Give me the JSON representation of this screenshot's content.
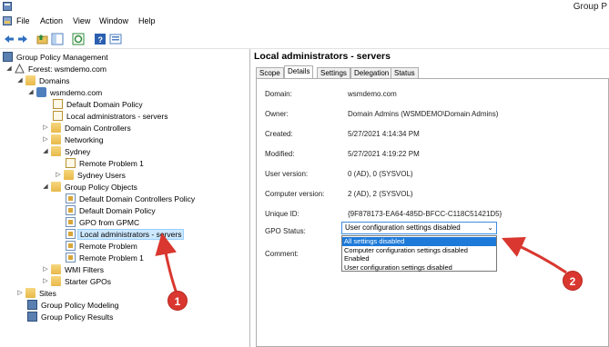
{
  "window": {
    "title": "Group P"
  },
  "menu": [
    "File",
    "Action",
    "View",
    "Window",
    "Help"
  ],
  "toolbar_icons": [
    "back-arrow-icon",
    "forward-arrow-icon",
    "up-folder-icon",
    "show-hide-tree-icon",
    "refresh-icon",
    "help-icon",
    "properties-icon"
  ],
  "tree": {
    "root": "Group Policy Management",
    "forest": "Forest: wsmdemo.com",
    "domains": "Domains",
    "domain": "wsmdemo.com",
    "items": {
      "default_domain_policy": "Default Domain Policy",
      "local_admins_servers_link": "Local administrators - servers",
      "domain_controllers": "Domain Controllers",
      "networking": "Networking",
      "sydney": "Sydney",
      "remote_problem_1_link": "Remote Problem 1",
      "sydney_users": "Sydney Users",
      "gpo_container": "Group Policy Objects",
      "gpo_ddcp": "Default Domain Controllers Policy",
      "gpo_ddp": "Default Domain Policy",
      "gpo_from_gpmc": "GPO from GPMC",
      "gpo_local_admins": "Local administrators - servers",
      "gpo_remote_problem": "Remote Problem",
      "gpo_remote_problem_1": "Remote Problem 1",
      "wmi_filters": "WMI Filters",
      "starter_gpos": "Starter GPOs",
      "sites": "Sites",
      "modeling": "Group Policy Modeling",
      "results": "Group Policy Results"
    }
  },
  "details": {
    "header": "Local administrators - servers",
    "tabs": [
      "Scope",
      "Details",
      "Settings",
      "Delegation",
      "Status"
    ],
    "rows": [
      {
        "label": "Domain:",
        "value": "wsmdemo.com"
      },
      {
        "label": "Owner:",
        "value": "Domain Admins (WSMDEMO\\Domain Admins)"
      },
      {
        "label": "Created:",
        "value": "5/27/2021 4:14:34 PM"
      },
      {
        "label": "Modified:",
        "value": "5/27/2021 4:19:22 PM"
      },
      {
        "label": "User version:",
        "value": "0 (AD), 0 (SYSVOL)"
      },
      {
        "label": "Computer version:",
        "value": "2 (AD), 2 (SYSVOL)"
      },
      {
        "label": "Unique ID:",
        "value": "{9F878173-EA64-485D-BFCC-C118C51421D5}"
      }
    ],
    "gpo_status_label": "GPO Status:",
    "gpo_status_value": "User configuration settings disabled",
    "gpo_status_options": [
      "All settings disabled",
      "Computer configuration settings disabled",
      "Enabled",
      "User configuration settings disabled"
    ],
    "comment_label": "Comment:"
  },
  "callouts": [
    "1",
    "2"
  ],
  "colors": {
    "selection": "#cce8ff",
    "dropdown_highlight": "#1e7ad9",
    "callout": "#d9372f"
  }
}
